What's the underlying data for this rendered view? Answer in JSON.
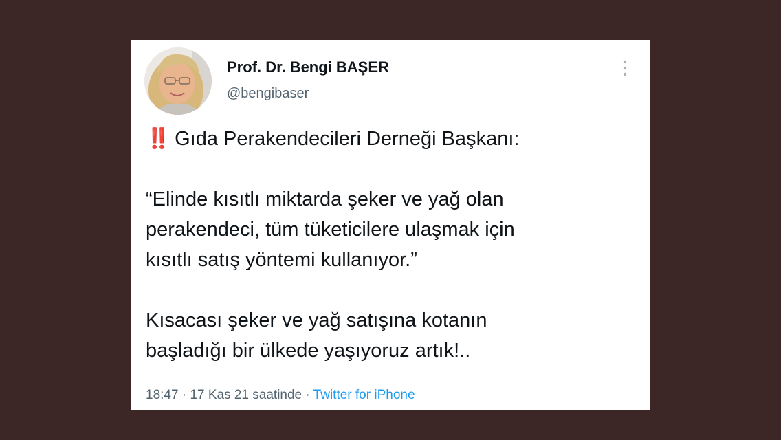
{
  "author": {
    "display_name": "Prof. Dr. Bengi BAŞER",
    "username": "@bengibaser"
  },
  "tweet": {
    "lines": [
      "Gıda Perakendecileri Derneği Başkanı:",
      "“Elinde kısıtlı miktarda şeker ve yağ olan",
      "perakendeci, tüm tüketicilere ulaşmak için",
      "kısıtlı satış yöntemi kullanıyor.”",
      "Kısacası şeker ve yağ satışına kotanın",
      "başladığı bir ülkede yaşıyoruz artık!.."
    ],
    "alert_emoji": "‼️"
  },
  "meta": {
    "time": "18:47",
    "separator": "·",
    "date": "17 Kas 21 saatinde",
    "source": "Twitter for iPhone"
  },
  "icons": {
    "more": "more-vertical-icon",
    "alert": "double-exclamation-icon"
  },
  "colors": {
    "background": "#3d2726",
    "card": "#ffffff",
    "text": "#0f1419",
    "secondary_text": "#536471",
    "link": "#1d9bf0",
    "alert": "#e0202a"
  }
}
